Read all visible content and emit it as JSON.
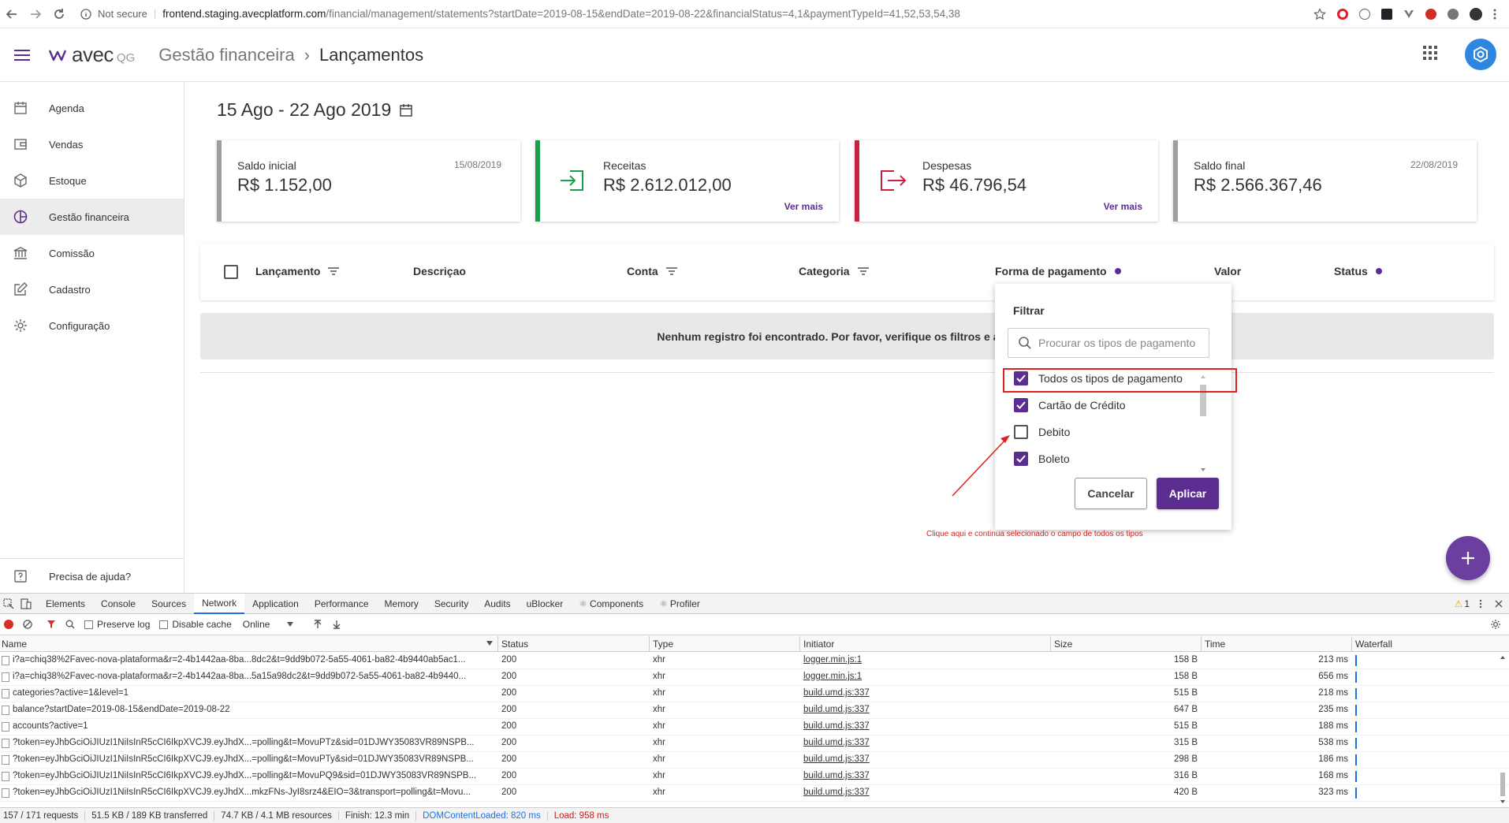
{
  "browser": {
    "security_label": "Not secure",
    "url_host": "frontend.staging.avecplatform.com",
    "url_path": "/financial/management/statements?startDate=2019-08-15&endDate=2019-08-22&financialStatus=4,1&paymentTypeId=41,52,53,54,38"
  },
  "header": {
    "logo_text": "avec",
    "logo_suffix": "QG",
    "breadcrumb_parent": "Gestão financeira",
    "breadcrumb_separator": "›",
    "breadcrumb_current": "Lançamentos",
    "accent_color": "#5c2d91"
  },
  "sidebar": {
    "items": [
      {
        "label": "Agenda",
        "icon": "calendar-icon"
      },
      {
        "label": "Vendas",
        "icon": "wallet-icon"
      },
      {
        "label": "Estoque",
        "icon": "box-icon"
      },
      {
        "label": "Gestão financeira",
        "icon": "finance-icon"
      },
      {
        "label": "Comissão",
        "icon": "bank-icon"
      },
      {
        "label": "Cadastro",
        "icon": "edit-icon"
      },
      {
        "label": "Configuração",
        "icon": "gear-icon"
      }
    ],
    "active_index": 3,
    "help_label": "Precisa de ajuda?"
  },
  "main": {
    "date_range": "15 Ago - 22 Ago 2019",
    "cards": [
      {
        "label": "Saldo inicial",
        "value": "R$ 1.152,00",
        "date": "15/08/2019",
        "border_color": "#9e9e9e"
      },
      {
        "label": "Receitas",
        "value": "R$ 2.612.012,00",
        "more": "Ver mais",
        "border_color": "#1b9e4b"
      },
      {
        "label": "Despesas",
        "value": "R$ 46.796,54",
        "more": "Ver mais",
        "border_color": "#c62042"
      },
      {
        "label": "Saldo final",
        "value": "R$ 2.566.367,46",
        "date": "22/08/2019",
        "border_color": "#9e9e9e"
      }
    ],
    "table_headers": {
      "lancamento": "Lançamento",
      "descricao": "Descriçao",
      "conta": "Conta",
      "categoria": "Categoria",
      "forma_pagamento": "Forma de pagamento",
      "valor": "Valor",
      "status": "Status"
    },
    "empty_message": "Nenhum registro foi encontrado. Por favor, verifique os filtros e as datas"
  },
  "filter": {
    "title": "Filtrar",
    "search_placeholder": "Procurar os tipos de pagamento",
    "options": [
      {
        "label": "Todos os tipos de pagamento",
        "checked": true
      },
      {
        "label": "Cartão de Crédito",
        "checked": true
      },
      {
        "label": "Debito",
        "checked": false
      },
      {
        "label": "Boleto",
        "checked": true
      }
    ],
    "cancel_label": "Cancelar",
    "apply_label": "Aplicar"
  },
  "annotation": {
    "note": "Clique aqui e continua selecionado o campo de todos os tipos",
    "color": "#e02020"
  },
  "devtools": {
    "tabs": [
      "Elements",
      "Console",
      "Sources",
      "Network",
      "Application",
      "Performance",
      "Memory",
      "Security",
      "Audits",
      "uBlocker",
      "Components",
      "Profiler"
    ],
    "active_tab": "Network",
    "warning_count": "1",
    "toolbar": {
      "preserve_log": "Preserve log",
      "disable_cache": "Disable cache",
      "throttle": "Online"
    },
    "columns": {
      "name": "Name",
      "status": "Status",
      "type": "Type",
      "initiator": "Initiator",
      "size": "Size",
      "time": "Time",
      "waterfall": "Waterfall"
    },
    "rows": [
      {
        "name": "i?a=chiq38%2Favec-nova-plataforma&r=2-4b1442aa-8ba...8dc2&t=9dd9b072-5a55-4061-ba82-4b9440ab5ac1...",
        "status": "200",
        "type": "xhr",
        "initiator": "logger.min.js:1",
        "size": "158 B",
        "time": "213 ms"
      },
      {
        "name": "i?a=chiq38%2Favec-nova-plataforma&r=2-4b1442aa-8ba...5a15a98dc2&t=9dd9b072-5a55-4061-ba82-4b9440...",
        "status": "200",
        "type": "xhr",
        "initiator": "logger.min.js:1",
        "size": "158 B",
        "time": "656 ms"
      },
      {
        "name": "categories?active=1&level=1",
        "status": "200",
        "type": "xhr",
        "initiator": "build.umd.js:337",
        "size": "515 B",
        "time": "218 ms"
      },
      {
        "name": "balance?startDate=2019-08-15&endDate=2019-08-22",
        "status": "200",
        "type": "xhr",
        "initiator": "build.umd.js:337",
        "size": "647 B",
        "time": "235 ms"
      },
      {
        "name": "accounts?active=1",
        "status": "200",
        "type": "xhr",
        "initiator": "build.umd.js:337",
        "size": "515 B",
        "time": "188 ms"
      },
      {
        "name": "?token=eyJhbGciOiJIUzI1NiIsInR5cCI6IkpXVCJ9.eyJhdX...=polling&t=MovuPTz&sid=01DJWY35083VR89NSPB...",
        "status": "200",
        "type": "xhr",
        "initiator": "build.umd.js:337",
        "size": "315 B",
        "time": "538 ms"
      },
      {
        "name": "?token=eyJhbGciOiJIUzI1NiIsInR5cCI6IkpXVCJ9.eyJhdX...=polling&t=MovuPTy&sid=01DJWY35083VR89NSPB...",
        "status": "200",
        "type": "xhr",
        "initiator": "build.umd.js:337",
        "size": "298 B",
        "time": "186 ms"
      },
      {
        "name": "?token=eyJhbGciOiJIUzI1NiIsInR5cCI6IkpXVCJ9.eyJhdX...=polling&t=MovuPQ9&sid=01DJWY35083VR89NSPB...",
        "status": "200",
        "type": "xhr",
        "initiator": "build.umd.js:337",
        "size": "316 B",
        "time": "168 ms"
      },
      {
        "name": "?token=eyJhbGciOiJIUzI1NiIsInR5cCI6IkpXVCJ9.eyJhdX...mkzFNs-JyI8srz4&EIO=3&transport=polling&t=Movu...",
        "status": "200",
        "type": "xhr",
        "initiator": "build.umd.js:337",
        "size": "420 B",
        "time": "323 ms"
      }
    ],
    "status_bar": {
      "requests": "157 / 171 requests",
      "transferred": "51.5 KB / 189 KB transferred",
      "resources": "74.7 KB / 4.1 MB resources",
      "finish": "Finish: 12.3 min",
      "dom_loaded": "DOMContentLoaded: 820 ms",
      "load": "Load: 958 ms"
    }
  }
}
